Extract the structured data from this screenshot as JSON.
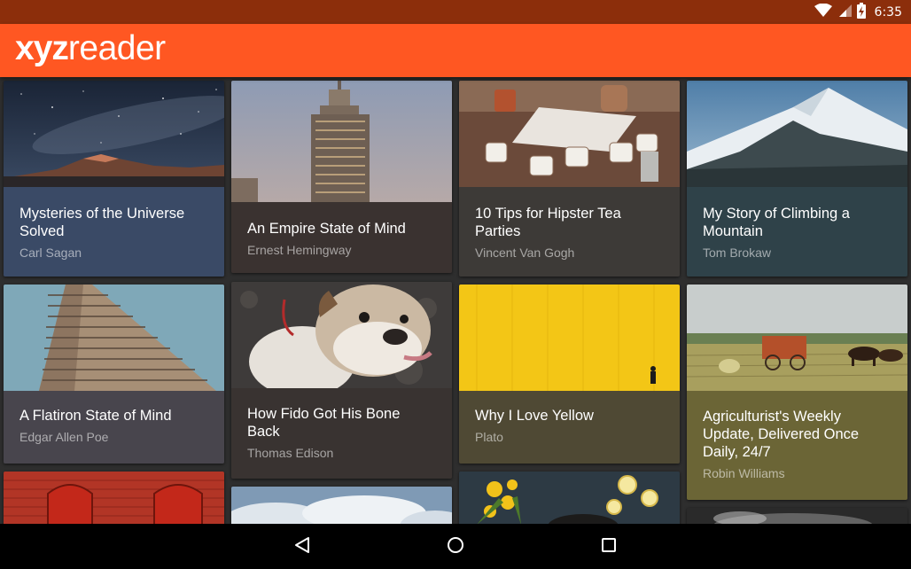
{
  "status_bar": {
    "time": "6:35",
    "icons": [
      "wifi-icon",
      "signal-icon",
      "battery-charging-icon"
    ]
  },
  "app_bar": {
    "logo_bold": "xyz",
    "logo_light": "reader",
    "color": "#ff5722"
  },
  "articles": [
    {
      "title": "Mysteries of the Universe Solved",
      "author": "Carl Sagan",
      "color": "#3a4a66",
      "image": "night-sky-mountains"
    },
    {
      "title": "An Empire State of Mind",
      "author": "Ernest Hemingway",
      "color": "#3a3230",
      "image": "empire-state-building"
    },
    {
      "title": "10 Tips for Hipster Tea Parties",
      "author": "Vincent Van Gogh",
      "color": "#3d3a37",
      "image": "tea-cups"
    },
    {
      "title": "My Story of Climbing a Mountain",
      "author": "Tom Brokaw",
      "color": "#2f4249",
      "image": "snowy-mountain"
    },
    {
      "title": "A Flatiron State of Mind",
      "author": "Edgar Allen Poe",
      "color": "#48454d",
      "image": "flatiron-building"
    },
    {
      "title": "How Fido Got His Bone Back",
      "author": "Thomas Edison",
      "color": "#393331",
      "image": "bulldog"
    },
    {
      "title": "Why I Love Yellow",
      "author": "Plato",
      "color": "#4f4934",
      "image": "yellow-wall"
    },
    {
      "title": "Agriculturist's Weekly Update, Delivered Once Daily, 24/7",
      "author": "Robin Williams",
      "color": "#6b6536",
      "image": "horse-farm"
    },
    {
      "title": "",
      "author": "",
      "color": "#a83224",
      "image": "red-doors"
    },
    {
      "title": "",
      "author": "",
      "color": "#7d98b0",
      "image": "clouds"
    },
    {
      "title": "",
      "author": "",
      "color": "#2d3a44",
      "image": "flowers-lemons"
    },
    {
      "title": "",
      "author": "",
      "color": "#2a2a2a",
      "image": "bw-photo"
    }
  ],
  "nav_bar": {
    "buttons": [
      "back-button",
      "home-button",
      "recents-button"
    ]
  }
}
